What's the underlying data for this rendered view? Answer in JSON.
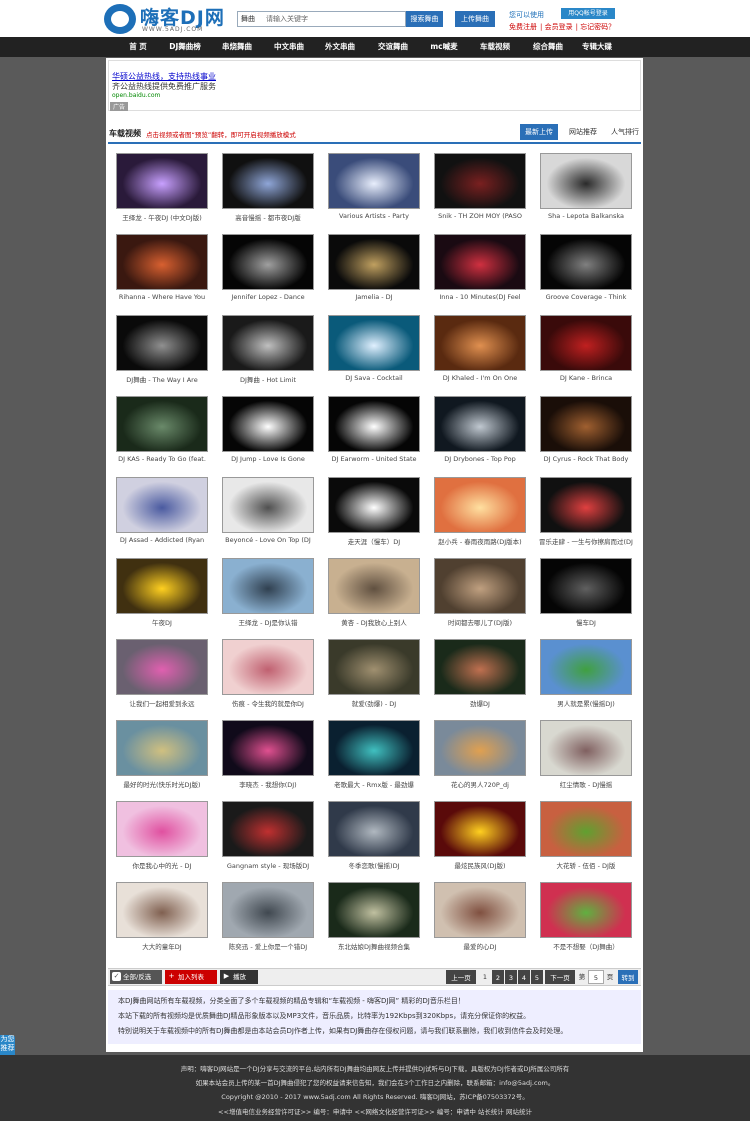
{
  "header": {
    "logo_name": "嗨客DJ网",
    "logo_url": "WWW.5ADJ.COM",
    "search_select": "舞曲",
    "search_placeholder": "请输入关键字",
    "search_button": "搜索舞曲",
    "upload_button": "上传舞曲",
    "qq_login": "用QQ帐号登录",
    "login_prompt": "您可以使用",
    "register": "免费注册",
    "member_login": "会员登录",
    "forgot": "忘记密码？"
  },
  "nav": [
    "首 页",
    "DJ舞曲榜",
    "串烧舞曲",
    "中文串曲",
    "外文串曲",
    "交谊舞曲",
    "mc喊麦",
    "车载视频",
    "综合舞曲",
    "专辑大碟"
  ],
  "ad": {
    "line1": "华硕公益热线，支持热线事业",
    "line2": "齐公益热线提供免费推广服务",
    "line3": "open.baidu.com",
    "tag": "广告"
  },
  "section": {
    "title": "车载视频",
    "note": "点击视频或者图“预览”翻转，即可开启视频播放模式",
    "tabs": [
      "最新上传",
      "网站推荐",
      "人气排行"
    ]
  },
  "videos": [
    {
      "caption": "王绎龙 - 午夜DJ (中文DJ版)",
      "bg": "#2a1a3a",
      "fg": "#c8a0ff"
    },
    {
      "caption": "高音慢摇 - 都市夜DJ版",
      "bg": "#101010",
      "fg": "#8fa6d8"
    },
    {
      "caption": "Various Artists - Party",
      "bg": "#3a4c7a",
      "fg": "#e8eefc"
    },
    {
      "caption": "Snik - TH ZOH MOY (PASO",
      "bg": "#111111",
      "fg": "#7a2020"
    },
    {
      "caption": "Sha - Lepota Balkanska",
      "bg": "#d8d8d8",
      "fg": "#2a2a2a"
    },
    {
      "caption": "Rihanna - Where Have You",
      "bg": "#3a1810",
      "fg": "#d86030"
    },
    {
      "caption": "Jennifer Lopez - Dance",
      "bg": "#050505",
      "fg": "#a0a0a0"
    },
    {
      "caption": "Jamelia - DJ",
      "bg": "#0a0a0a",
      "fg": "#c0a060"
    },
    {
      "caption": "Inna - 10 Minutes(DJ Feel",
      "bg": "#1a0a12",
      "fg": "#d03040"
    },
    {
      "caption": "Groove Coverage - Think",
      "bg": "#050505",
      "fg": "#808080"
    },
    {
      "caption": "DJ舞曲 - The Way I Are",
      "bg": "#0a0a0a",
      "fg": "#909090"
    },
    {
      "caption": "DJ舞曲 - Hot Limit",
      "bg": "#1a1a1a",
      "fg": "#c0c0c0"
    },
    {
      "caption": "DJ Sava - Cocktail",
      "bg": "#0a5a7a",
      "fg": "#e0f0ff"
    },
    {
      "caption": "DJ Khaled - I'm On One",
      "bg": "#5a2a10",
      "fg": "#e09050"
    },
    {
      "caption": "DJ Kane - Brinca",
      "bg": "#3a0a0a",
      "fg": "#c02020"
    },
    {
      "caption": "DJ KAS - Ready To Go (feat.",
      "bg": "#1a2a1a",
      "fg": "#6a8a6a"
    },
    {
      "caption": "DJ Jump - Love Is Gone",
      "bg": "#050505",
      "fg": "#ffffff"
    },
    {
      "caption": "DJ Earworm - United State",
      "bg": "#050505",
      "fg": "#ffffff"
    },
    {
      "caption": "DJ Drybones - Top Pop",
      "bg": "#101820",
      "fg": "#c0c8d0"
    },
    {
      "caption": "DJ Cyrus - Rock That Body",
      "bg": "#1a0e08",
      "fg": "#a06030"
    },
    {
      "caption": "DJ Assad - Addicted (Ryan",
      "bg": "#d0d0e0",
      "fg": "#4a5aa0"
    },
    {
      "caption": "Beyoncé - Love On Top (DJ",
      "bg": "#e8e8e8",
      "fg": "#505050"
    },
    {
      "caption": "走天涯（慢车）DJ",
      "bg": "#0a0a0a",
      "fg": "#ffffff"
    },
    {
      "caption": "赵小兵 - 春雨夜雨路(DJ版本)",
      "bg": "#e07040",
      "fg": "#ffe0a0"
    },
    {
      "caption": "冒乐走肆 - 一生与你擦肩而过(DJ",
      "bg": "#101010",
      "fg": "#e04040"
    },
    {
      "caption": "午夜DJ",
      "bg": "#403010",
      "fg": "#ffd020"
    },
    {
      "caption": "王绎龙 - DJ是你认错",
      "bg": "#8ab0d0",
      "fg": "#304050"
    },
    {
      "caption": "黄杏 - DJ我放心上别人",
      "bg": "#c8b090",
      "fg": "#605040"
    },
    {
      "caption": "时间都去哪儿了(DJ版)",
      "bg": "#504030",
      "fg": "#c0a080"
    },
    {
      "caption": "慢车DJ",
      "bg": "#050505",
      "fg": "#606060"
    },
    {
      "caption": "让我们一起相爱到永远",
      "bg": "#6a6070",
      "fg": "#e060b0"
    },
    {
      "caption": "伤痕 - 令生我的就是你DJ",
      "bg": "#f0d0d0",
      "fg": "#c06070"
    },
    {
      "caption": "就爱(劲爆) - DJ",
      "bg": "#3a3a2a",
      "fg": "#a09070"
    },
    {
      "caption": "劲爆DJ",
      "bg": "#1a2a1a",
      "fg": "#c07050"
    },
    {
      "caption": "男人就是累(慢摇DJ)",
      "bg": "#5a90d0",
      "fg": "#40a040"
    },
    {
      "caption": "最好的时光(快乐时光DJ版)",
      "bg": "#6a90a0",
      "fg": "#d0c080"
    },
    {
      "caption": "李晓杰 - 我想你(DJ)",
      "bg": "#100a1a",
      "fg": "#e05090"
    },
    {
      "caption": "老歌最大 - Rmx版 - 最劲爆",
      "bg": "#0a2030",
      "fg": "#40c0c0"
    },
    {
      "caption": "花心的男人720P_dj",
      "bg": "#7a8a9a",
      "fg": "#e0a050"
    },
    {
      "caption": "红尘情歌 - DJ慢摇",
      "bg": "#d8d8d0",
      "fg": "#806060"
    },
    {
      "caption": "你是我心中的光 - DJ",
      "bg": "#f0c0e0",
      "fg": "#e050a0"
    },
    {
      "caption": "Gangnam style - 现场版DJ",
      "bg": "#1a1a1a",
      "fg": "#c03030"
    },
    {
      "caption": "冬季恋歌(慢摇)DJ",
      "bg": "#303a4a",
      "fg": "#b0b8c0"
    },
    {
      "caption": "最炫民族风(DJ版)",
      "bg": "#5a0a0a",
      "fg": "#ffd020"
    },
    {
      "caption": "大花轿 - 伍佰 - DJ版",
      "bg": "#c86040",
      "fg": "#60a030"
    },
    {
      "caption": "大大的童年DJ",
      "bg": "#e8e0d8",
      "fg": "#806050"
    },
    {
      "caption": "陈奕迅 - 爱上你是一个错DJ",
      "bg": "#a0a8b0",
      "fg": "#404850"
    },
    {
      "caption": "东北姑娘DJ舞曲视频合集",
      "bg": "#1a2a1a",
      "fg": "#c0c0a0"
    },
    {
      "caption": "最爱的心DJ",
      "bg": "#d0c0b0",
      "fg": "#805040"
    },
    {
      "caption": "不是不想娶（DJ舞曲）",
      "bg": "#d03050",
      "fg": "#60b040"
    }
  ],
  "toolbar": {
    "all_select": "全部/反选",
    "add_list": "加入列表",
    "play": "播放",
    "prev": "上一页",
    "pages": [
      "1",
      "2",
      "3",
      "4",
      "5"
    ],
    "next": "下一页",
    "goto_label": "第",
    "goto_value": "5",
    "goto_unit": "页",
    "go": "转到"
  },
  "info": {
    "line1": "本DJ舞曲网站所有车载视频，分类全面了多个车载视频的精品专辑和“车载视频 - 嗨客DJ网” 精彩的DJ音乐栏目！",
    "line2": "本站下载的所有视频均是优质舞曲DJ精品形象版本以及MP3文件，音乐品质，比特率为192Kbps到320Kbps，请充分保证你的权益。",
    "line3": "特别说明关于车载视频中的所有DJ舞曲都是由本站会员DJ作者上传，如果有DJ舞曲存在侵权问题，请与我们联系删除，我们收到信件会及时处理。"
  },
  "footer": {
    "line1": "声明：嗨客DJ网站是一个DJ分享与交流的平台,站内所有DJ舞曲均由网友上传并提供DJ试听与DJ下载，具版权为DJ作者或DJ所属公司所有",
    "line2": "如果本站会员上传的某一首DJ舞曲侵犯了您的权益请来信告知，我们会在3个工作日之内删除，联系邮箱：info@5adj.com。",
    "line3": "Copyright @2010 - 2017 www.5adj.com All Rights Reserved. 嗨客DJ网站，苏ICP备07503372号。",
    "line4": "<<增值电信业务经营许可证>> 编号：申请中 <<网络文化经营许可证>> 编号：申请中 站长统计 网站统计"
  },
  "side_badge": "为您推荐"
}
